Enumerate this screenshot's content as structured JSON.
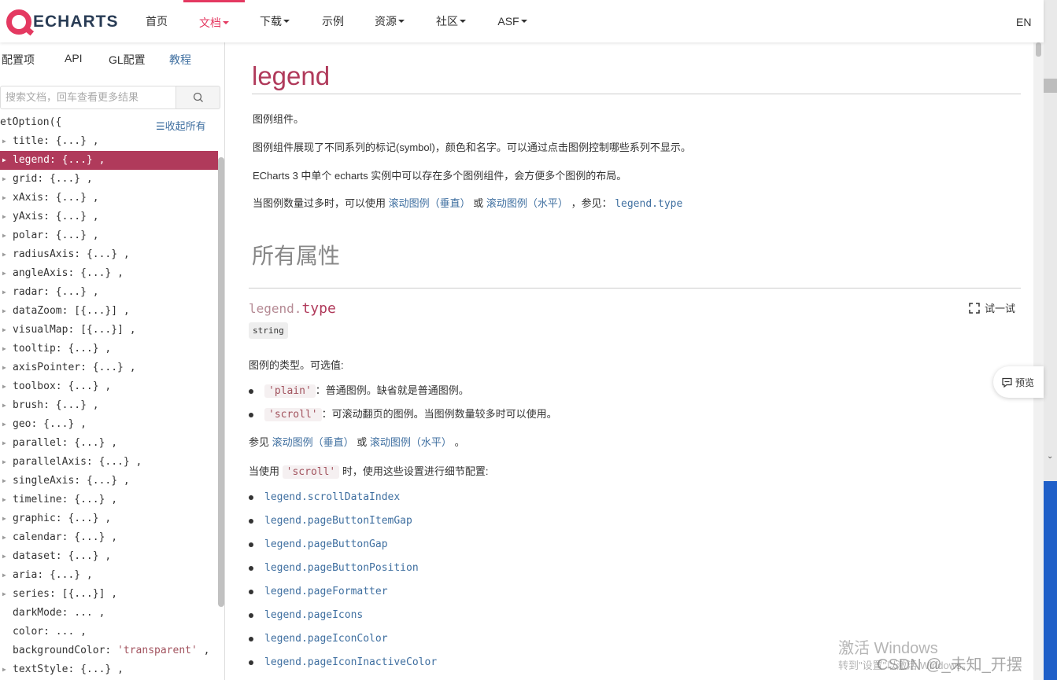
{
  "header": {
    "logo_text": "ECHARTS",
    "nav": [
      {
        "label": "首页",
        "dropdown": false
      },
      {
        "label": "文档",
        "dropdown": true,
        "active": true
      },
      {
        "label": "下载",
        "dropdown": true
      },
      {
        "label": "示例",
        "dropdown": false
      },
      {
        "label": "资源",
        "dropdown": true
      },
      {
        "label": "社区",
        "dropdown": true
      },
      {
        "label": "ASF",
        "dropdown": true
      }
    ],
    "lang": "EN",
    "accent": "#e43961"
  },
  "sidebar": {
    "tabs": [
      "配置项",
      "API",
      "GL配置",
      "教程"
    ],
    "search_placeholder": "搜索文档，回车查看更多结果",
    "root": "etOption({",
    "collapse_all": "☰收起所有",
    "items": [
      {
        "key": "title",
        "val": "{...}"
      },
      {
        "key": "legend",
        "val": "{...}",
        "selected": true
      },
      {
        "key": "grid",
        "val": "{...}"
      },
      {
        "key": "xAxis",
        "val": "{...}"
      },
      {
        "key": "yAxis",
        "val": "{...}"
      },
      {
        "key": "polar",
        "val": "{...}"
      },
      {
        "key": "radiusAxis",
        "val": "{...}"
      },
      {
        "key": "angleAxis",
        "val": "{...}"
      },
      {
        "key": "radar",
        "val": "{...}"
      },
      {
        "key": "dataZoom",
        "val": "[{...}]"
      },
      {
        "key": "visualMap",
        "val": "[{...}]"
      },
      {
        "key": "tooltip",
        "val": "{...}"
      },
      {
        "key": "axisPointer",
        "val": "{...}"
      },
      {
        "key": "toolbox",
        "val": "{...}"
      },
      {
        "key": "brush",
        "val": "{...}"
      },
      {
        "key": "geo",
        "val": "{...}"
      },
      {
        "key": "parallel",
        "val": "{...}"
      },
      {
        "key": "parallelAxis",
        "val": "{...}"
      },
      {
        "key": "singleAxis",
        "val": "{...}"
      },
      {
        "key": "timeline",
        "val": "{...}"
      },
      {
        "key": "graphic",
        "val": "{...}"
      },
      {
        "key": "calendar",
        "val": "{...}"
      },
      {
        "key": "dataset",
        "val": "{...}"
      },
      {
        "key": "aria",
        "val": "{...}"
      },
      {
        "key": "series",
        "val": "[{...}]"
      },
      {
        "key": "darkMode",
        "val": "...",
        "leaf": true
      },
      {
        "key": "color",
        "val": "...",
        "leaf": true
      },
      {
        "key": "backgroundColor",
        "val": "'transparent'",
        "leaf": true,
        "string": true
      },
      {
        "key": "textStyle",
        "val": "{...}"
      }
    ],
    "selected_color": "#b03a5b"
  },
  "main": {
    "title": "legend",
    "desc1": "图例组件。",
    "desc2": "图例组件展现了不同系列的标记(symbol)，颜色和名字。可以通过点击图例控制哪些系列不显示。",
    "desc3": "ECharts 3 中单个 echarts 实例中可以存在多个图例组件，会方便多个图例的布局。",
    "desc4_pre": "当图例数量过多时，可以使用",
    "desc4_link1": "滚动图例（垂直）",
    "desc4_mid": "或",
    "desc4_link2": "滚动图例（水平）",
    "desc4_post": "，参见：",
    "desc4_link3": "legend.type",
    "all_props": "所有属性",
    "prop": {
      "prefix": "legend.",
      "name": "type",
      "type_badge": "string",
      "try_label": "试一试",
      "intro": "图例的类型。可选值:",
      "opt1_code": "'plain'",
      "opt1_text": "：普通图例。缺省就是普通图例。",
      "opt2_code": "'scroll'",
      "opt2_text": "：可滚动翻页的图例。当图例数量较多时可以使用。",
      "see_pre": "参见",
      "see_link1": "滚动图例（垂直）",
      "see_mid": "或",
      "see_link2": "滚动图例（水平）",
      "see_post": "。",
      "when_pre": "当使用",
      "when_code": "'scroll'",
      "when_post": "时，使用这些设置进行细节配置:",
      "links": [
        "legend.scrollDataIndex",
        "legend.pageButtonItemGap",
        "legend.pageButtonGap",
        "legend.pageButtonPosition",
        "legend.pageFormatter",
        "legend.pageIcons",
        "legend.pageIconColor",
        "legend.pageIconInactiveColor"
      ]
    }
  },
  "preview_label": "预览",
  "watermark": {
    "line1": "激活 Windows",
    "line2": "转到\"设置\"以激活 Windows。",
    "csdn": "CSDN @_未知_开摆"
  }
}
